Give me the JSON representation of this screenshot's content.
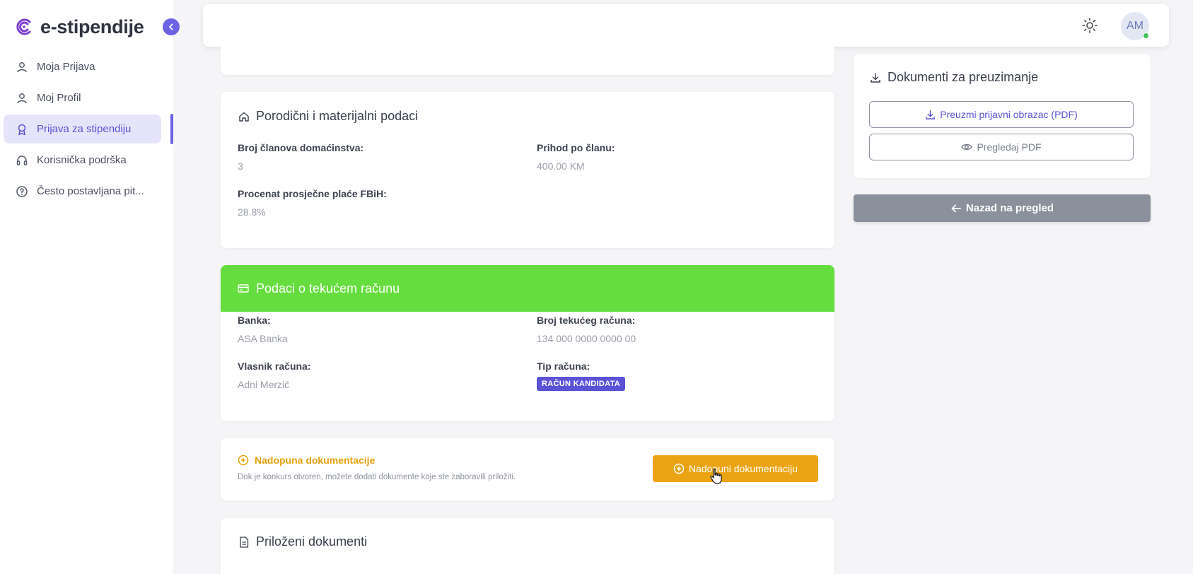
{
  "app": {
    "name": "e-stipendije"
  },
  "sidebar": {
    "items": [
      {
        "label": "Moja Prijava",
        "icon": "user-icon",
        "active": false
      },
      {
        "label": "Moj Profil",
        "icon": "user-icon",
        "active": false
      },
      {
        "label": "Prijava za stipendiju",
        "icon": "award-icon",
        "active": true
      },
      {
        "label": "Korisnička podrška",
        "icon": "headset-icon",
        "active": false
      },
      {
        "label": "Često postavljana pit...",
        "icon": "help-circle-icon",
        "active": false
      }
    ]
  },
  "topbar": {
    "avatar_initials": "AM",
    "theme_icon": "sun-icon"
  },
  "family": {
    "title": "Porodični i materijalni podaci",
    "household_label": "Broj članova domaćinstva:",
    "household_value": "3",
    "income_label": "Prihod po članu:",
    "income_value": "400.00 KM",
    "percent_label": "Procenat prosječne plaće FBiH:",
    "percent_value": "28.8%"
  },
  "account": {
    "title": "Podaci o tekućem računu",
    "bank_label": "Banka:",
    "bank_value": "ASA Banka",
    "number_label": "Broj tekućeg računa:",
    "number_value": "134 000 0000 0000 00",
    "owner_label": "Vlasnik računa:",
    "owner_value": "Adni Merzić",
    "type_label": "Tip računa:",
    "type_badge": "RAČUN KANDIDATA"
  },
  "supplement": {
    "title": "Nadopuna dokumentacije",
    "description": "Dok je konkurs otvoren, možete dodati dokumente koje ste zaboravili priložiti.",
    "button": "Nadopuni dokumentaciju"
  },
  "attached": {
    "title": "Priloženi dokumenti"
  },
  "downloads": {
    "title": "Dokumenti za preuzimanje",
    "download_button": "Preuzmi prijavni obrazac (PDF)",
    "preview_button": "Pregledaj PDF"
  },
  "back_button": "Nazad na pregled",
  "colors": {
    "accent": "#6c63e6",
    "green_header": "#66dd3e",
    "orange": "#eaa312",
    "back_button": "#8a919d"
  }
}
